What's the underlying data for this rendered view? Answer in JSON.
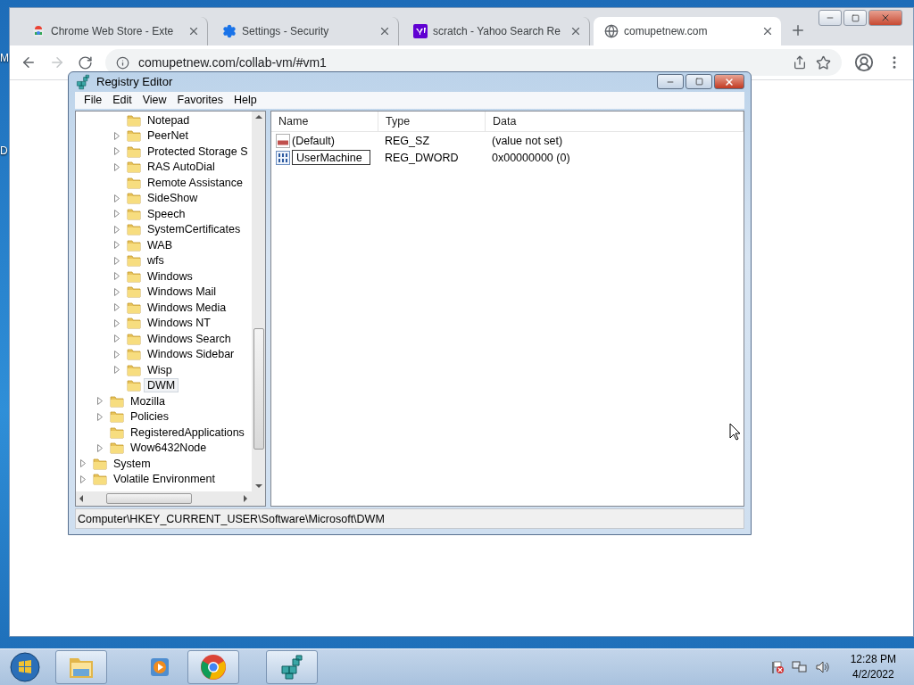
{
  "desktop": {
    "edge_labels": [
      "M",
      "D"
    ]
  },
  "browser": {
    "tabs": [
      {
        "kind": "store",
        "title": "Chrome Web Store - Exte",
        "selected": false
      },
      {
        "kind": "settings",
        "title": "Settings - Security",
        "selected": false
      },
      {
        "kind": "yahoo",
        "title": "scratch - Yahoo Search Re",
        "selected": false
      },
      {
        "kind": "globe",
        "title": "comupetnew.com",
        "selected": true
      }
    ],
    "address": "comupetnew.com/collab-vm/#vm1",
    "forward_enabled": false
  },
  "regedit": {
    "title": "Registry Editor",
    "menu": [
      "File",
      "Edit",
      "View",
      "Favorites",
      "Help"
    ],
    "tree": [
      {
        "children": [
          {
            "children": [
              {
                "label": "Notepad",
                "has_children": false,
                "selected": false
              },
              {
                "label": "PeerNet",
                "has_children": true,
                "selected": false
              },
              {
                "label": "Protected Storage S",
                "has_children": true,
                "selected": false
              },
              {
                "label": "RAS AutoDial",
                "has_children": true,
                "selected": false
              },
              {
                "label": "Remote Assistance",
                "has_children": false,
                "selected": false
              },
              {
                "label": "SideShow",
                "has_children": true,
                "selected": false
              },
              {
                "label": "Speech",
                "has_children": true,
                "selected": false
              },
              {
                "label": "SystemCertificates",
                "has_children": true,
                "selected": false
              },
              {
                "label": "WAB",
                "has_children": true,
                "selected": false
              },
              {
                "label": "wfs",
                "has_children": true,
                "selected": false
              },
              {
                "label": "Windows",
                "has_children": true,
                "selected": false
              },
              {
                "label": "Windows Mail",
                "has_children": true,
                "selected": false
              },
              {
                "label": "Windows Media",
                "has_children": true,
                "selected": false
              },
              {
                "label": "Windows NT",
                "has_children": true,
                "selected": false
              },
              {
                "label": "Windows Search",
                "has_children": true,
                "selected": false
              },
              {
                "label": "Windows Sidebar",
                "has_children": true,
                "selected": false
              },
              {
                "label": "Wisp",
                "has_children": true,
                "selected": false
              },
              {
                "label": "DWM",
                "has_children": false,
                "selected": true
              }
            ]
          },
          {
            "label": "Mozilla",
            "has_children": true,
            "selected": false
          },
          {
            "label": "Policies",
            "has_children": true,
            "selected": false
          },
          {
            "label": "RegisteredApplications",
            "has_children": false,
            "selected": false
          },
          {
            "label": "Wow6432Node",
            "has_children": true,
            "selected": false
          }
        ]
      },
      {
        "label": "System",
        "has_children": true,
        "selected": false
      },
      {
        "label": "Volatile Environment",
        "has_children": true,
        "selected": false
      }
    ],
    "columns": [
      "Name",
      "Type",
      "Data"
    ],
    "values": [
      {
        "kind": "string",
        "name": "(Default)",
        "type": "REG_SZ",
        "data": "(value not set)",
        "editing": false
      },
      {
        "kind": "dword",
        "name": "UserMachine",
        "type": "REG_DWORD",
        "data": "0x00000000 (0)",
        "editing": true
      }
    ],
    "status": "Computer\\HKEY_CURRENT_USER\\Software\\Microsoft\\DWM"
  },
  "taskbar": {
    "items": [
      {
        "kind": "explorer",
        "running": true
      },
      {
        "kind": "media",
        "running": false
      },
      {
        "kind": "chrome",
        "running": true
      },
      {
        "kind": "regedit",
        "running": true
      }
    ],
    "time": "12:28 PM",
    "date": "4/2/2022"
  }
}
